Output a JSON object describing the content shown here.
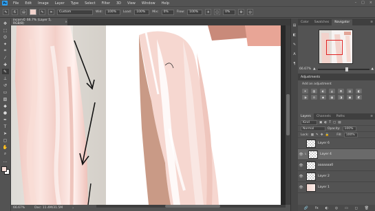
{
  "app": {
    "logo": "Ps"
  },
  "menu": [
    "File",
    "Edit",
    "Image",
    "Layer",
    "Type",
    "Select",
    "Filter",
    "3D",
    "View",
    "Window",
    "Help"
  ],
  "window_controls": [
    "–",
    "□",
    "×"
  ],
  "options_bar": {
    "tool_icon": "brush-icon",
    "brush_size": "6",
    "preset": "Custom",
    "width_label": "Wid:",
    "width_value": "100%",
    "load_label": "Load:",
    "load_value": "100%",
    "mix_label": "Mix:",
    "mix_value": "0%",
    "flow_label": "Flow:",
    "flow_value": "100%",
    "smoothing_value": "0%"
  },
  "document": {
    "tab_title": "incorn© 66.7% (Layer 5, RGB/8)",
    "close": "×"
  },
  "status": {
    "zoom": "66.67%",
    "doc_size": "Doc: 11.4M/31.5M"
  },
  "panels": {
    "top_tabs": [
      "Color",
      "Swatches",
      "Navigator"
    ],
    "active_top_tab": "Navigator",
    "navigator_zoom": "66.67%",
    "adjustments_title": "Adjustments",
    "adjustments_subtitle": "Add an adjustment",
    "adj_icons": [
      "☀",
      "▥",
      "◐",
      "◭",
      "◓",
      "▤",
      "◧",
      "◑",
      "⚖",
      "◉",
      "▦",
      "◨",
      "▣",
      "◩"
    ],
    "layers_tabs": [
      "Layers",
      "Channels",
      "Paths"
    ],
    "active_layers_tab": "Layers",
    "kind_label": "Kind",
    "blend_mode": "Normal",
    "opacity_label": "Opacity:",
    "opacity_value": "100%",
    "lock_label": "Lock:",
    "fill_label": "Fill:",
    "fill_value": "100%",
    "layers": [
      {
        "name": "Layer 6",
        "selected": false,
        "visible": false,
        "clipped": false,
        "thumb": "empty"
      },
      {
        "name": "Layer 4",
        "selected": true,
        "visible": true,
        "clipped": true,
        "thumb": "empty"
      },
      {
        "name": "aaaaaaa0",
        "selected": false,
        "visible": true,
        "clipped": false,
        "thumb": "empty"
      },
      {
        "name": "Layer 2",
        "selected": false,
        "visible": true,
        "clipped": false,
        "thumb": "empty"
      },
      {
        "name": "Layer 1",
        "selected": false,
        "visible": true,
        "clipped": false,
        "thumb": "photo"
      }
    ],
    "footer_icons": [
      "🔗",
      "fx",
      "◐",
      "◎",
      "▭",
      "◻",
      "🗑"
    ]
  }
}
